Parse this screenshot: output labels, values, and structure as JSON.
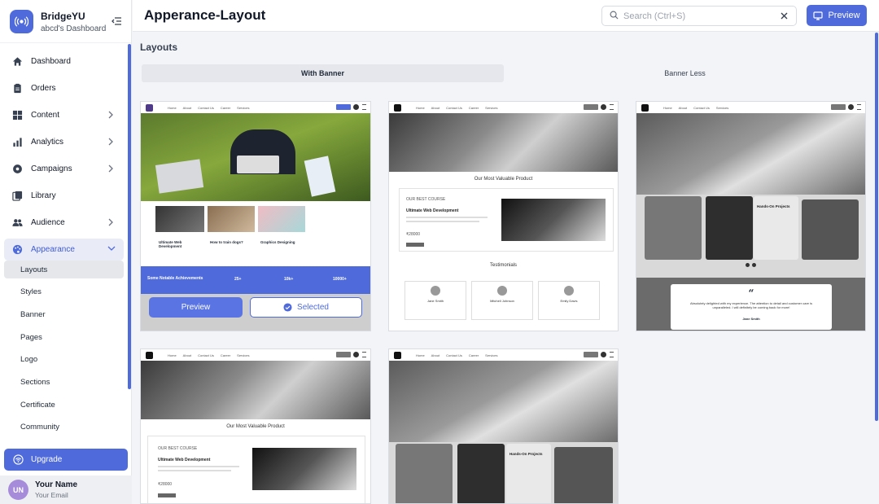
{
  "app": {
    "name": "BridgeYU",
    "subtitle": "abcd's Dashboard"
  },
  "sidebar": {
    "items": [
      {
        "label": "Dashboard",
        "icon": "home-icon"
      },
      {
        "label": "Orders",
        "icon": "clipboard-icon"
      },
      {
        "label": "Content",
        "icon": "grid-icon",
        "has_chevron": true
      },
      {
        "label": "Analytics",
        "icon": "bar-chart-icon",
        "has_chevron": true
      },
      {
        "label": "Campaigns",
        "icon": "gear-badge-icon",
        "has_chevron": true
      },
      {
        "label": "Library",
        "icon": "library-icon"
      },
      {
        "label": "Audience",
        "icon": "users-icon",
        "has_chevron": true
      },
      {
        "label": "Appearance",
        "icon": "palette-icon",
        "has_chevron": true,
        "expanded": true
      }
    ],
    "sub_items": [
      "Layouts",
      "Styles",
      "Banner",
      "Pages",
      "Logo",
      "Sections",
      "Certificate",
      "Community"
    ],
    "selected_sub": "Layouts",
    "upgrade_label": "Upgrade",
    "profile": {
      "initials": "UN",
      "name": "Your Name",
      "email": "Your Email"
    }
  },
  "header": {
    "title": "Apperance-Layout",
    "search_placeholder": "Search (Ctrl+S)",
    "preview_label": "Preview"
  },
  "main": {
    "section_title": "Layouts",
    "tabs": [
      {
        "label": "With Banner",
        "active": true
      },
      {
        "label": "Banner Less",
        "active": false
      }
    ],
    "cards": [
      {
        "selected": true,
        "preview_label": "Preview",
        "selected_label": "Selected",
        "band_title": "Some Notable Achievements",
        "stats": [
          "25+",
          "10k+",
          "10000+"
        ],
        "course_titles": [
          "Ultimate Web Development",
          "How to train dogs?",
          "Graphics Designing"
        ]
      },
      {
        "section": "Our Most Valuable Product",
        "course_label": "OUR BEST COURSE",
        "course_title": "Ultimate Web Development",
        "price": "₹28000",
        "testimonials_title": "Testimonials",
        "testimonial_names": [
          "Jane Smith",
          "Mitchell Johnson",
          "Emily Davis"
        ]
      },
      {
        "feature_title": "Hands-On Projects",
        "quote": "Absolutely delighted with my experience. The attention to detail and customer care is unparalleled. I will definitely be coming back for more!",
        "quote_author": "Jane Smith"
      },
      {
        "section": "Our Most Valuable Product",
        "course_label": "OUR BEST COURSE",
        "course_title": "Ultimate Web Development",
        "price": "₹28000"
      },
      {
        "feature_title": "Hands-On Projects"
      }
    ],
    "mini_nav_links": [
      "Home",
      "About",
      "Contact Us",
      "Career",
      "Services"
    ],
    "mini_register": "Register"
  },
  "colors": {
    "accent": "#4f6bdb",
    "active_bg": "#e9ecf6"
  }
}
